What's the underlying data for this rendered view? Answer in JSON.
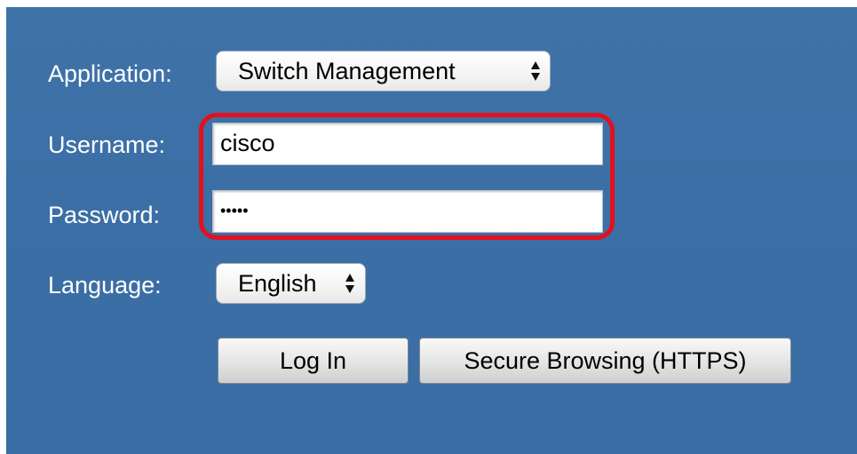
{
  "form": {
    "application_label": "Application:",
    "application_value": "Switch Management",
    "username_label": "Username:",
    "username_value": "cisco",
    "password_label": "Password:",
    "password_value": "•••••",
    "language_label": "Language:",
    "language_value": "English"
  },
  "buttons": {
    "login_label": "Log In",
    "secure_label": "Secure Browsing (HTTPS)"
  },
  "colors": {
    "panel_background": "#3b6fa5",
    "highlight_border": "#e3101d"
  },
  "icons": {
    "select_arrows": "up-down-chevron-icon"
  }
}
